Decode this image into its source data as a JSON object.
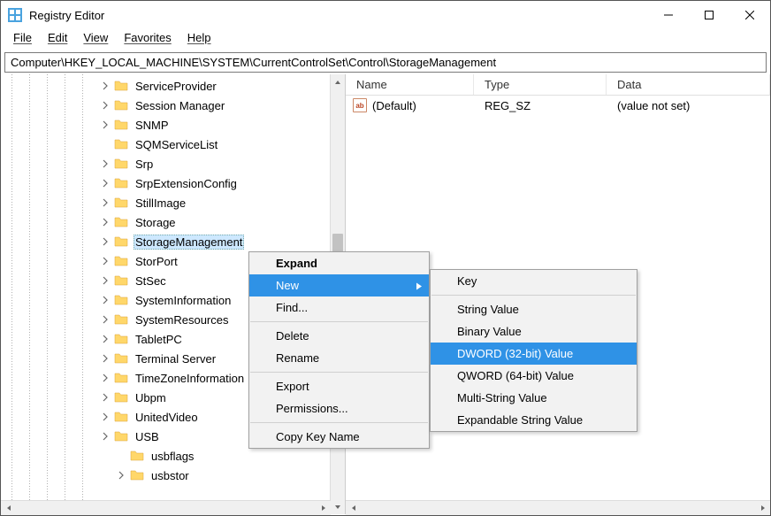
{
  "window": {
    "title": "Registry Editor"
  },
  "menu": {
    "file": "File",
    "edit": "Edit",
    "view": "View",
    "favorites": "Favorites",
    "help": "Help"
  },
  "address": "Computer\\HKEY_LOCAL_MACHINE\\SYSTEM\\CurrentControlSet\\Control\\StorageManagement",
  "tree_items": [
    {
      "label": "ServiceProvider",
      "expand": true,
      "indent": 0
    },
    {
      "label": "Session Manager",
      "expand": true,
      "indent": 0
    },
    {
      "label": "SNMP",
      "expand": true,
      "indent": 0
    },
    {
      "label": "SQMServiceList",
      "expand": false,
      "indent": 0
    },
    {
      "label": "Srp",
      "expand": true,
      "indent": 0
    },
    {
      "label": "SrpExtensionConfig",
      "expand": true,
      "indent": 0
    },
    {
      "label": "StillImage",
      "expand": true,
      "indent": 0
    },
    {
      "label": "Storage",
      "expand": true,
      "indent": 0
    },
    {
      "label": "StorageManagement",
      "expand": true,
      "indent": 0,
      "selected": true
    },
    {
      "label": "StorPort",
      "expand": true,
      "indent": 0
    },
    {
      "label": "StSec",
      "expand": true,
      "indent": 0
    },
    {
      "label": "SystemInformation",
      "expand": true,
      "indent": 0
    },
    {
      "label": "SystemResources",
      "expand": true,
      "indent": 0
    },
    {
      "label": "TabletPC",
      "expand": true,
      "indent": 0
    },
    {
      "label": "Terminal Server",
      "expand": true,
      "indent": 0
    },
    {
      "label": "TimeZoneInformation",
      "expand": true,
      "indent": 0
    },
    {
      "label": "Ubpm",
      "expand": true,
      "indent": 0
    },
    {
      "label": "UnitedVideo",
      "expand": true,
      "indent": 0
    },
    {
      "label": "USB",
      "expand": true,
      "indent": 0
    },
    {
      "label": "usbflags",
      "expand": false,
      "indent": 1
    },
    {
      "label": "usbstor",
      "expand": true,
      "indent": 1
    }
  ],
  "list": {
    "headers": {
      "name": "Name",
      "type": "Type",
      "data": "Data"
    },
    "rows": [
      {
        "name": "(Default)",
        "type": "REG_SZ",
        "data": "(value not set)"
      }
    ]
  },
  "context_main": {
    "expand": "Expand",
    "new": "New",
    "find": "Find...",
    "delete": "Delete",
    "rename": "Rename",
    "export": "Export",
    "permissions": "Permissions...",
    "copy_key": "Copy Key Name"
  },
  "context_sub": {
    "key": "Key",
    "string": "String Value",
    "binary": "Binary Value",
    "dword": "DWORD (32-bit) Value",
    "qword": "QWORD (64-bit) Value",
    "multi": "Multi-String Value",
    "expandable": "Expandable String Value"
  }
}
